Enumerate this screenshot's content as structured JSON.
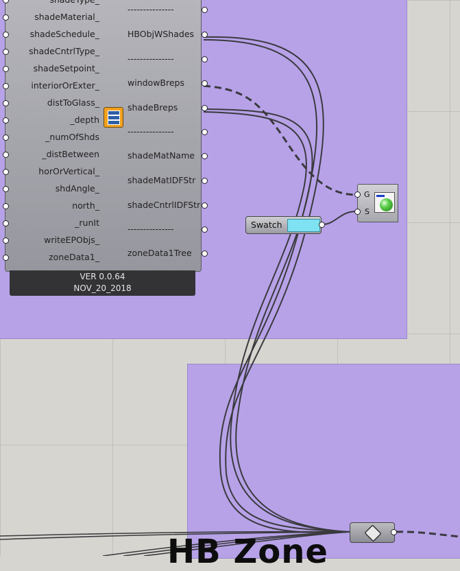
{
  "canvas": {
    "background": "#d7d5cf",
    "group_color": "#b7a2e8"
  },
  "component": {
    "inputs": [
      "shadeType_",
      "shadeMaterial_",
      "shadeSchedule_",
      "shadeCntrlType_",
      "shadeSetpoint_",
      "interiorOrExter_",
      "distToGlass_",
      "_depth",
      "_numOfShds",
      "_distBetween",
      "horOrVertical_",
      "shdAngle_",
      "north_",
      "_runIt",
      "writeEPObjs_",
      "zoneData1_"
    ],
    "outputs": [
      "---------------",
      "HBObjWShades",
      "---------------",
      "windowBreps",
      "shadeBreps",
      "---------------",
      "shadeMatName",
      "shadeMatIDFStr",
      "shadeCntrlIDFStr",
      "---------------",
      "zoneData1Tree"
    ],
    "version_line1": "VER 0.0.64",
    "version_line2": "NOV_20_2018"
  },
  "swatch": {
    "label": "Swatch",
    "color": "#7fe2f2"
  },
  "preview": {
    "input_g": "G",
    "input_s": "S"
  },
  "group_label": "HB Zone"
}
